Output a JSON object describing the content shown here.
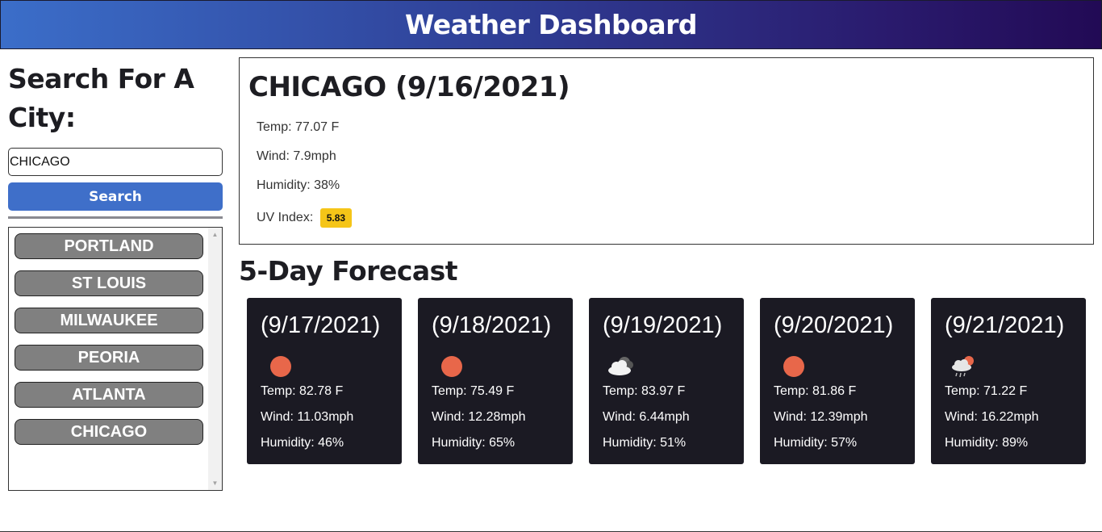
{
  "header": {
    "title": "Weather Dashboard"
  },
  "sidebar": {
    "title": "Search For A City:",
    "search_value": "CHICAGO",
    "search_button": "Search",
    "history": [
      "PORTLAND",
      "ST LOUIS",
      "MILWAUKEE",
      "PEORIA",
      "ATLANTA",
      "CHICAGO"
    ]
  },
  "current": {
    "title": "CHICAGO (9/16/2021)",
    "temp": "Temp: 77.07 F",
    "wind": "Wind: 7.9mph",
    "humidity": "Humidity: 38%",
    "uv_label": "UV Index:",
    "uv_value": "5.83",
    "uv_color": "#f5c518"
  },
  "forecast": {
    "title": "5-Day Forecast",
    "days": [
      {
        "date": "(9/17/2021)",
        "icon": "sun-icon",
        "temp": "Temp: 82.78 F",
        "wind": "Wind: 11.03mph",
        "humidity": "Humidity: 46%"
      },
      {
        "date": "(9/18/2021)",
        "icon": "sun-icon",
        "temp": "Temp: 75.49 F",
        "wind": "Wind: 12.28mph",
        "humidity": "Humidity: 65%"
      },
      {
        "date": "(9/19/2021)",
        "icon": "cloudy-icon",
        "temp": "Temp: 83.97 F",
        "wind": "Wind: 6.44mph",
        "humidity": "Humidity: 51%"
      },
      {
        "date": "(9/20/2021)",
        "icon": "sun-icon",
        "temp": "Temp: 81.86 F",
        "wind": "Wind: 12.39mph",
        "humidity": "Humidity: 57%"
      },
      {
        "date": "(9/21/2021)",
        "icon": "rain-icon",
        "temp": "Temp: 71.22 F",
        "wind": "Wind: 16.22mph",
        "humidity": "Humidity: 89%"
      }
    ]
  },
  "colors": {
    "header_gradient_start": "#3b6ec9",
    "header_gradient_end": "#220a55",
    "search_button": "#3f6fc9",
    "history_button": "#808080",
    "forecast_card": "#1b1a23",
    "sun": "#e8674a"
  }
}
